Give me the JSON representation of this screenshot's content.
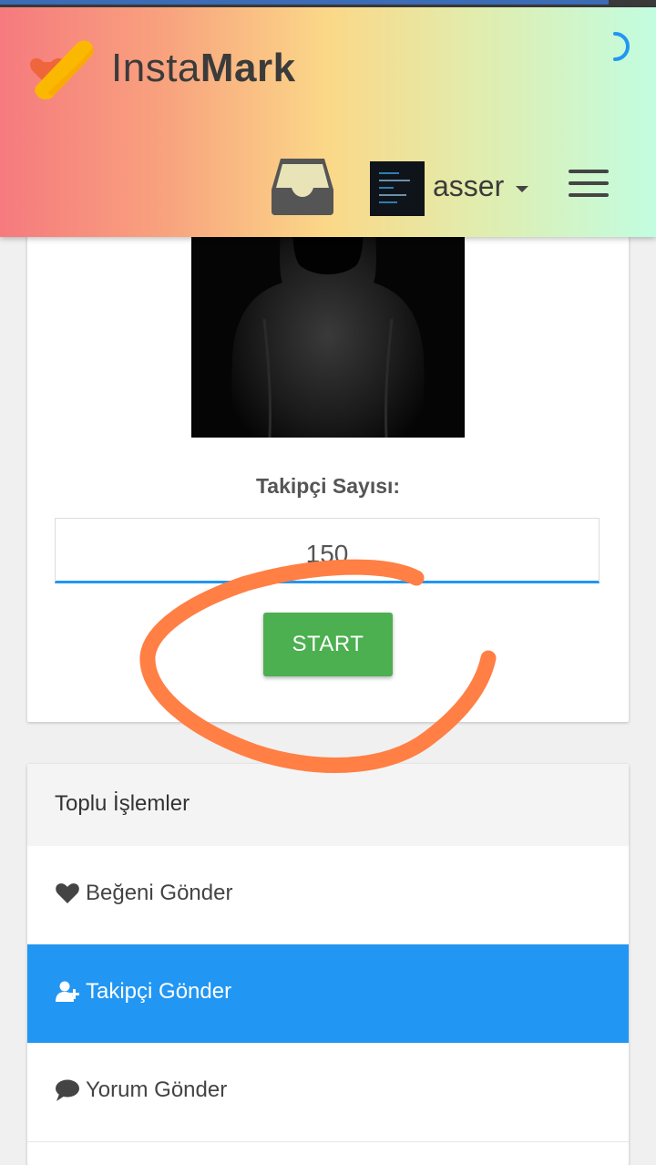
{
  "header": {
    "brand_regular": "Insta",
    "brand_bold": "Mark",
    "username": "asser"
  },
  "icons": [
    "logo-icon",
    "spinner-icon",
    "inbox-icon",
    "caret-down-icon",
    "hamburger-menu-icon",
    "heart-icon",
    "user-plus-icon",
    "comment-icon"
  ],
  "colors": {
    "accent_blue": "#2196f3",
    "start_green": "#4caf50",
    "annotation_orange": "#ff7f45"
  },
  "follower_form": {
    "label": "Takipçi Sayısı:",
    "count_value": "150",
    "start_label": "START"
  },
  "bulk_operations": {
    "title": "Toplu İşlemler",
    "items": [
      {
        "label": "Beğeni Gönder",
        "icon": "heart-icon",
        "active": false
      },
      {
        "label": "Takipçi Gönder",
        "icon": "user-plus-icon",
        "active": true
      },
      {
        "label": "Yorum Gönder",
        "icon": "comment-icon",
        "active": false
      }
    ]
  }
}
